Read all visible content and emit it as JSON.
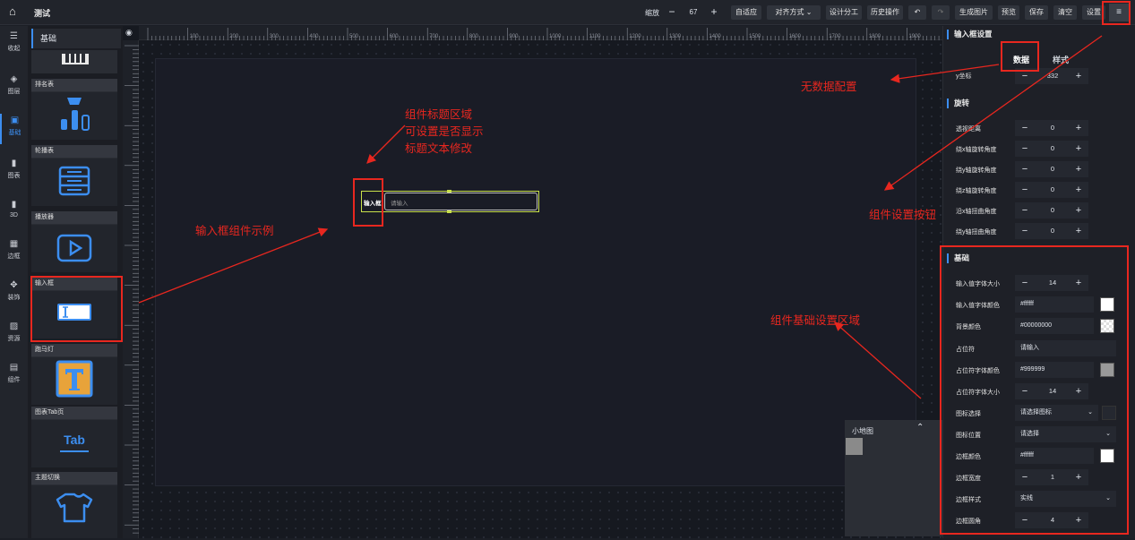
{
  "app": {
    "title": "测试",
    "zoom_label": "缩放",
    "zoom_value": "67"
  },
  "toolbar": {
    "auto_fit": "自适应",
    "align": "对齐方式",
    "design_split": "设计分工",
    "history": "历史操作",
    "undo_icon": "undo-icon",
    "redo_icon": "redo-icon",
    "gen_image": "生成图片",
    "preview": "预览",
    "save": "保存",
    "clear": "清空",
    "settings": "设置",
    "menu_glyph": "≡"
  },
  "leftnav": [
    {
      "label": "收起",
      "icon": "collapse-icon",
      "glyph": "☰"
    },
    {
      "label": "图层",
      "icon": "layers-icon",
      "glyph": "◈"
    },
    {
      "label": "基础",
      "icon": "cube-icon",
      "glyph": "▣"
    },
    {
      "label": "图表",
      "icon": "bar-chart-icon",
      "glyph": "▮"
    },
    {
      "label": "3D",
      "icon": "3d-chart-icon",
      "glyph": "▮"
    },
    {
      "label": "边框",
      "icon": "border-icon",
      "glyph": "▦"
    },
    {
      "label": "装饰",
      "icon": "decoration-icon",
      "glyph": "✥"
    },
    {
      "label": "资源",
      "icon": "image-icon",
      "glyph": "▨"
    },
    {
      "label": "组件",
      "icon": "component-icon",
      "glyph": "▤"
    }
  ],
  "comp_panel": {
    "title": "基础",
    "cards": [
      {
        "label": "排名表"
      },
      {
        "label": "轮播表"
      },
      {
        "label": "播放器"
      },
      {
        "label": "输入框"
      },
      {
        "label": "跑马灯"
      },
      {
        "label": "图表Tab页",
        "icon_text": "Tab"
      },
      {
        "label": "主题切换"
      }
    ]
  },
  "canvas": {
    "ruler_ticks": [
      "100",
      "200",
      "300",
      "400",
      "500",
      "600",
      "700",
      "800",
      "900",
      "1000",
      "1100",
      "1200",
      "1300",
      "1400",
      "1500",
      "1600",
      "1700",
      "1800",
      "1900"
    ],
    "input_title": "输入框",
    "input_placeholder": "请输入"
  },
  "minimap": {
    "title": "小地图"
  },
  "rightpanel": {
    "header": "输入框设置",
    "tabs": [
      "数据",
      "样式"
    ],
    "y_label": "y坐标",
    "y_value": "332",
    "rotate_title": "旋转",
    "rotate_rows": [
      {
        "label": "透视距离",
        "value": "0"
      },
      {
        "label": "绕x轴旋转角度",
        "value": "0"
      },
      {
        "label": "绕y轴旋转角度",
        "value": "0"
      },
      {
        "label": "绕z轴旋转角度",
        "value": "0"
      },
      {
        "label": "沿x轴扭曲角度",
        "value": "0"
      },
      {
        "label": "绕y轴扭曲角度",
        "value": "0"
      }
    ],
    "basic_title": "基础",
    "basic": {
      "font_size_label": "输入值字体大小",
      "font_size": "14",
      "font_color_label": "输入值字体颜色",
      "font_color": "#ffffff",
      "bg_color_label": "背景颜色",
      "bg_color": "#00000000",
      "placeholder_label": "占位符",
      "placeholder": "请输入",
      "ph_color_label": "占位符字体颜色",
      "ph_color": "#999999",
      "ph_size_label": "占位符字体大小",
      "ph_size": "14",
      "icon_label": "图标选择",
      "icon_value": "请选择图标",
      "icon_pos_label": "图标位置",
      "icon_pos_value": "请选择",
      "border_color_label": "边框颜色",
      "border_color": "#ffffff",
      "border_width_label": "边框宽度",
      "border_width": "1",
      "border_style_label": "边框样式",
      "border_style": "实线",
      "radius_label": "边框圆角",
      "radius": "4"
    }
  },
  "annotations": {
    "no_data": "无数据配置",
    "title_area_1": "组件标题区域",
    "title_area_2": "可设置是否显示",
    "title_area_3": "标题文本修改",
    "input_example": "输入框组件示例",
    "settings_btn": "组件设置按钮",
    "basic_area": "组件基础设置区域"
  },
  "colors": {
    "accent": "#3c8ef0",
    "annotation": "#e8271f",
    "highlight": "#c8e04a"
  }
}
